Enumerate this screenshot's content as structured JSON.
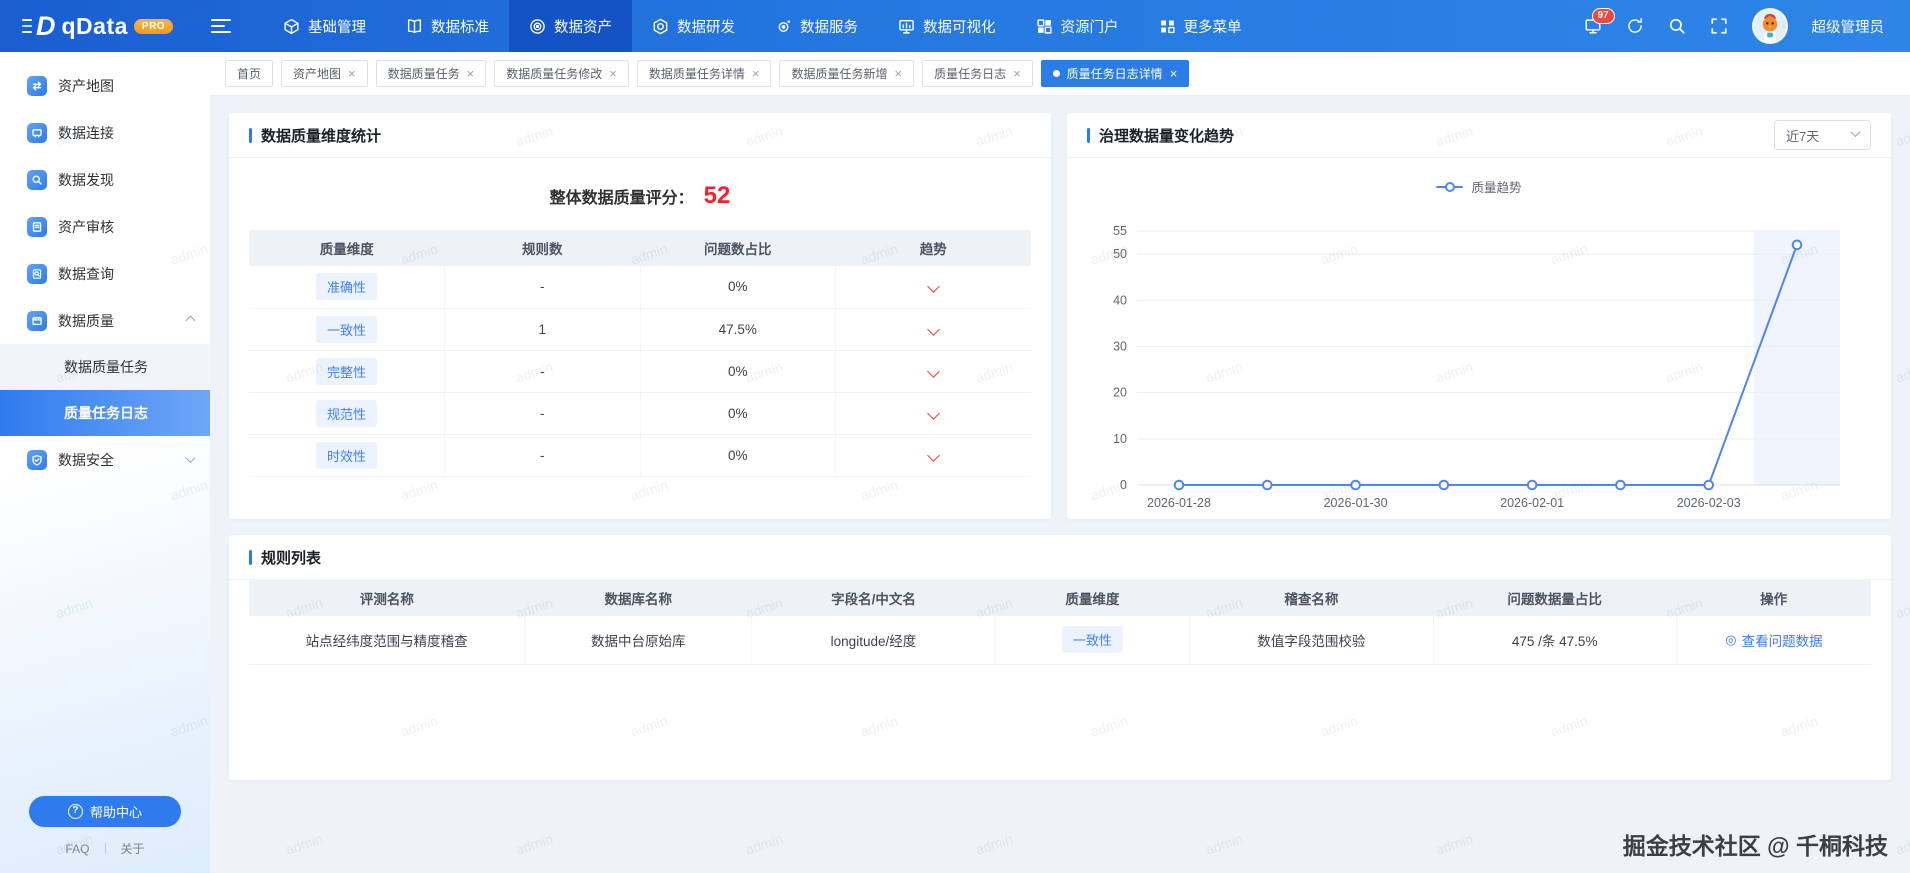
{
  "navbar": {
    "logo": "qData",
    "pro_badge": "PRO",
    "notification_count": "97",
    "user": "超级管理员",
    "items": [
      {
        "key": "basic-management",
        "label": "基础管理",
        "icon": "cube-icon",
        "active": false
      },
      {
        "key": "data-standard",
        "label": "数据标准",
        "icon": "book-icon",
        "active": false
      },
      {
        "key": "data-asset",
        "label": "数据资产",
        "icon": "target-icon",
        "active": true
      },
      {
        "key": "data-dev",
        "label": "数据研发",
        "icon": "hexagon-icon",
        "active": false
      },
      {
        "key": "data-service",
        "label": "数据服务",
        "icon": "orbit-icon",
        "active": false
      },
      {
        "key": "data-visualization",
        "label": "数据可视化",
        "icon": "monitor-chart-icon",
        "active": false
      },
      {
        "key": "resource-portal",
        "label": "资源门户",
        "icon": "grid-icon",
        "active": false
      },
      {
        "key": "more-menu",
        "label": "更多菜单",
        "icon": "more-icon",
        "active": false
      }
    ]
  },
  "sidebar": {
    "items": [
      {
        "key": "asset-map",
        "label": "资产地图",
        "icon": "map-icon"
      },
      {
        "key": "data-connection",
        "label": "数据连接",
        "icon": "connection-icon"
      },
      {
        "key": "data-discovery",
        "label": "数据发现",
        "icon": "discovery-icon"
      },
      {
        "key": "asset-audit",
        "label": "资产审核",
        "icon": "audit-icon"
      },
      {
        "key": "data-query",
        "label": "数据查询",
        "icon": "query-icon"
      },
      {
        "key": "data-quality",
        "label": "数据质量",
        "icon": "quality-icon",
        "expanded": true,
        "children": [
          {
            "key": "quality-task",
            "label": "数据质量任务",
            "active": false
          },
          {
            "key": "quality-task-log",
            "label": "质量任务日志",
            "active": true
          }
        ]
      },
      {
        "key": "data-security",
        "label": "数据安全",
        "icon": "security-icon",
        "expanded": false
      }
    ],
    "help_label": "帮助中心",
    "faq_label": "FAQ",
    "about_label": "关于"
  },
  "tabs": [
    {
      "key": "home",
      "label": "首页",
      "closable": false,
      "active": false
    },
    {
      "key": "asset-map",
      "label": "资产地图",
      "closable": true,
      "active": false
    },
    {
      "key": "quality-task",
      "label": "数据质量任务",
      "closable": true,
      "active": false
    },
    {
      "key": "quality-task-edit",
      "label": "数据质量任务修改",
      "closable": true,
      "active": false
    },
    {
      "key": "quality-task-detail",
      "label": "数据质量任务详情",
      "closable": true,
      "active": false
    },
    {
      "key": "quality-task-add",
      "label": "数据质量任务新增",
      "closable": true,
      "active": false
    },
    {
      "key": "quality-task-log",
      "label": "质量任务日志",
      "closable": true,
      "active": false
    },
    {
      "key": "quality-task-log-detail",
      "label": "质量任务日志详情",
      "closable": true,
      "active": true
    }
  ],
  "quality": {
    "title": "数据质量维度统计",
    "score_label": "整体数据质量评分：",
    "score": "52",
    "table": {
      "headers": [
        "质量维度",
        "规则数",
        "问题数占比",
        "趋势"
      ],
      "rows": [
        {
          "dimension": "准确性",
          "rules": "-",
          "ratio": "0%",
          "trend": "down"
        },
        {
          "dimension": "一致性",
          "rules": "1",
          "ratio": "47.5%",
          "trend": "down"
        },
        {
          "dimension": "完整性",
          "rules": "-",
          "ratio": "0%",
          "trend": "down"
        },
        {
          "dimension": "规范性",
          "rules": "-",
          "ratio": "0%",
          "trend": "down"
        },
        {
          "dimension": "时效性",
          "rules": "-",
          "ratio": "0%",
          "trend": "down"
        }
      ]
    }
  },
  "trend": {
    "title": "治理数据量变化趋势",
    "range": "近7天"
  },
  "chart_data": {
    "type": "line",
    "title": "治理数据量变化趋势",
    "legend_position": "top",
    "grid": true,
    "x": [
      "2026-01-28",
      "2026-01-29",
      "2026-01-30",
      "2026-01-31",
      "2026-02-01",
      "2026-02-02",
      "2026-02-03",
      "2026-02-04"
    ],
    "x_tick_labels": [
      "2026-01-28",
      "2026-01-30",
      "2026-02-01",
      "2026-02-03"
    ],
    "series": [
      {
        "name": "质量趋势",
        "values": [
          0,
          0,
          0,
          0,
          0,
          0,
          0,
          52
        ],
        "color": "#4f86ec"
      }
    ],
    "ylim": [
      0,
      55
    ],
    "yticks": [
      0,
      10,
      20,
      30,
      40,
      50,
      55
    ]
  },
  "rules": {
    "title": "规则列表",
    "table": {
      "headers": [
        "评测名称",
        "数据库名称",
        "字段名/中文名",
        "质量维度",
        "稽查名称",
        "问题数据量占比",
        "操作"
      ],
      "rows": [
        {
          "name": "站点经纬度范围与精度稽查",
          "database": "数据中台原始库",
          "field": "longitude/经度",
          "dimension": "一致性",
          "check": "数值字段范围校验",
          "ratio": "475 /条 47.5%",
          "action": "查看问题数据"
        }
      ]
    }
  },
  "watermark": "admin",
  "footer": "掘金技术社区 @ 千桐科技",
  "colors": {
    "primary": "#2b7ce5",
    "navbar_start": "#1a5ed2",
    "navbar_end": "#2e85e8",
    "score_red": "#f5222d",
    "trend_red": "#f23c3c",
    "link_blue": "#3a7cf0",
    "line_blue": "#4f86ec",
    "tag_bg": "#ecf3fe"
  }
}
